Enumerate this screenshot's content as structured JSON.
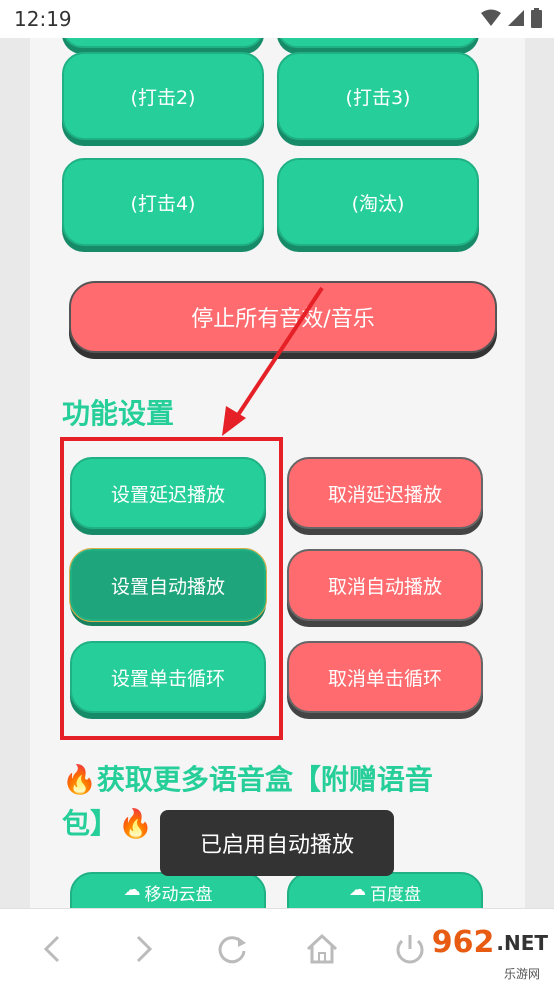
{
  "status_bar": {
    "time": "12:19"
  },
  "buttons": {
    "hit2": "(打击2)",
    "hit3": "(打击3)",
    "hit4": "(打击4)",
    "eliminate": "(淘汰)",
    "stop_all": "停止所有音效/音乐",
    "set_delay": "设置延迟播放",
    "cancel_delay": "取消延迟播放",
    "set_autoplay": "设置自动播放",
    "cancel_autoplay": "取消自动播放",
    "set_loop": "设置单击循环",
    "cancel_loop": "取消单击循环",
    "mobile_cloud": "移动云盘",
    "baidu_pan": "百度盘"
  },
  "sections": {
    "settings": "功能设置",
    "more_line1": "🔥获取更多语音盒【附赠语音",
    "more_line2": "包】🔥"
  },
  "toast": "已启用自动播放",
  "watermark": {
    "brand": "962",
    "suffix": ".NET",
    "sub": "乐游网"
  },
  "colors": {
    "green": "#26cf99",
    "red": "#ff6b6e",
    "highlight": "#e52026"
  }
}
